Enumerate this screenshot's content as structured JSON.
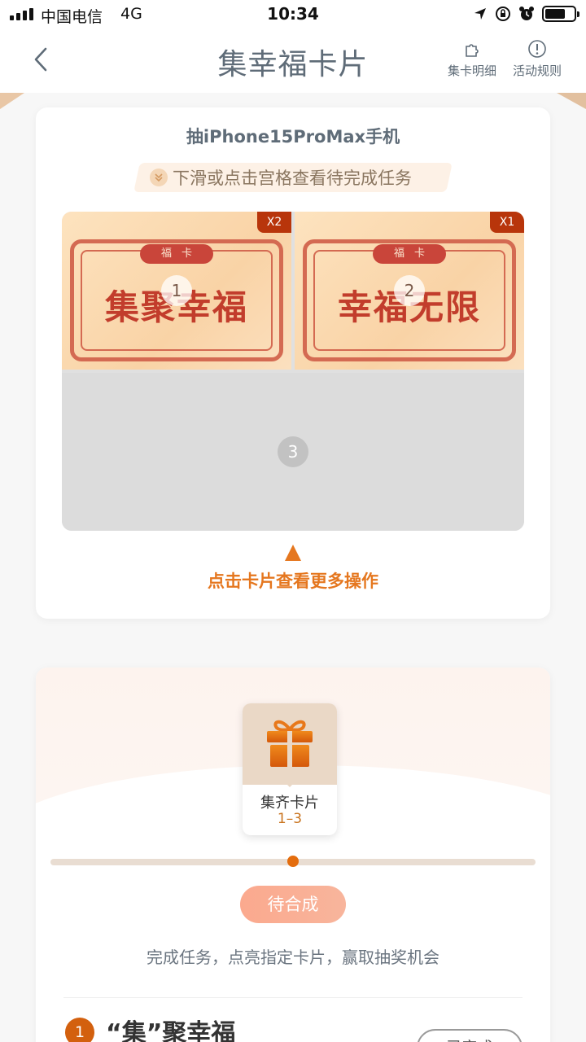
{
  "status_bar": {
    "carrier": "中国电信",
    "network": "4G",
    "time": "10:34"
  },
  "nav": {
    "title": "集幸福卡片",
    "actions": [
      {
        "label": "集卡明细",
        "icon": "puzzle-icon"
      },
      {
        "label": "活动规则",
        "icon": "info-icon"
      }
    ]
  },
  "cards_panel": {
    "title": "抽iPhone15ProMax手机",
    "hint": "下滑或点击宫格查看待完成任务",
    "cards": [
      {
        "number": "1",
        "tag": "福卡",
        "text": "集聚幸福",
        "count": "X2"
      },
      {
        "number": "2",
        "tag": "福卡",
        "text": "幸福无限",
        "count": "X1"
      }
    ],
    "empty_slot_number": "3",
    "cta": "点击卡片查看更多操作"
  },
  "reward_panel": {
    "prize_label": "集齐卡片",
    "prize_range": "1–3",
    "progress": 0.5,
    "status_button": "待合成",
    "description": "完成任务，点亮指定卡片，赢取抽奖机会",
    "task": {
      "number": "1",
      "title": "“集”聚幸福",
      "button": "已完成"
    }
  },
  "colors": {
    "accent": "#e5771f",
    "card_red": "#c23d2c",
    "text_gray": "#5f6c78"
  }
}
